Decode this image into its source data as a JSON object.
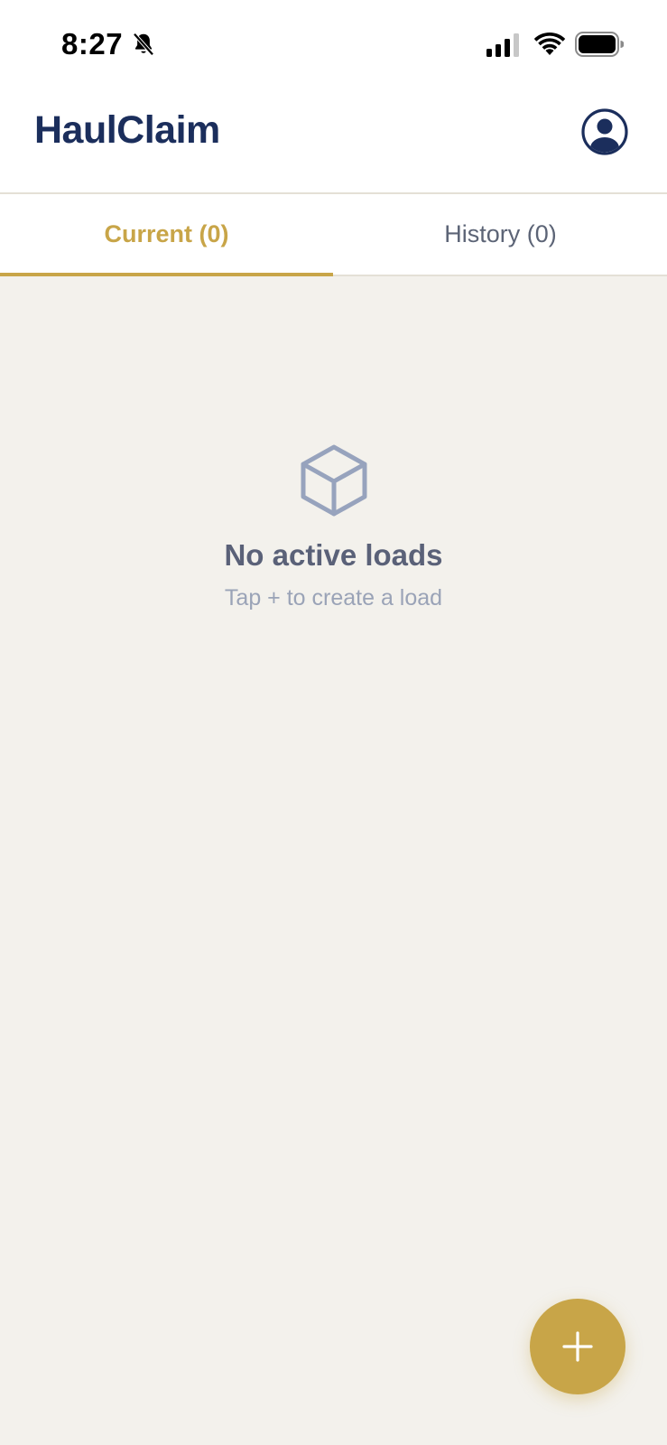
{
  "status_bar": {
    "time": "8:27",
    "icons": [
      "bell-slash-icon",
      "cellular-signal-icon",
      "wifi-icon",
      "battery-icon"
    ]
  },
  "header": {
    "title": "HaulClaim",
    "profile_icon": "user-circle-icon"
  },
  "tabs": [
    {
      "label": "Current (0)",
      "active": true
    },
    {
      "label": "History (0)",
      "active": false
    }
  ],
  "empty_state": {
    "icon": "cube-icon",
    "title": "No active loads",
    "subtitle": "Tap + to create a load"
  },
  "fab": {
    "icon": "plus-icon"
  },
  "colors": {
    "brand_navy": "#1b2e5c",
    "accent_gold": "#c8a548",
    "background": "#f3f1ec",
    "muted_text": "#9aa3b7",
    "empty_title": "#5a6178"
  }
}
